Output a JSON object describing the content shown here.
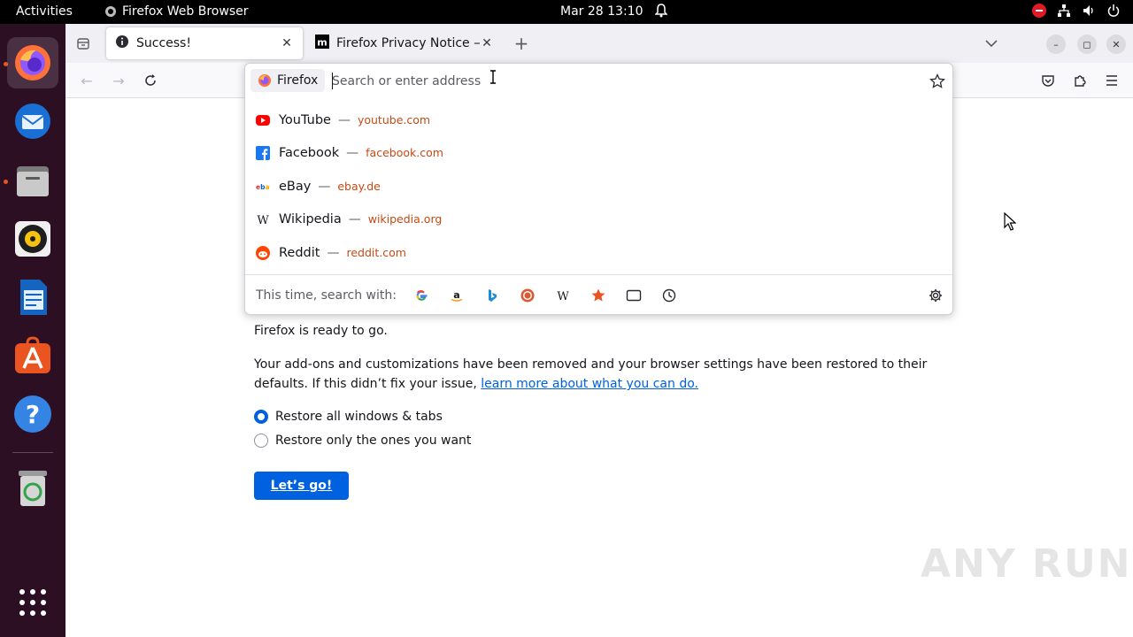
{
  "topbar": {
    "activities": "Activities",
    "app_name": "Firefox Web Browser",
    "clock": "Mar 28  13:10"
  },
  "dock": {
    "apps": [
      "firefox",
      "thunderbird",
      "files",
      "rhythmbox",
      "libreoffice-writer",
      "app-center",
      "help",
      "trash",
      "show-apps"
    ]
  },
  "tabs": [
    {
      "title": "Success!",
      "icon": "info-icon"
    },
    {
      "title": "Firefox Privacy Notice —",
      "icon": "mozilla-icon"
    }
  ],
  "urlbar": {
    "engine": "Firefox",
    "placeholder": "Search or enter address",
    "value": ""
  },
  "suggestions": [
    {
      "title": "YouTube",
      "url": "youtube.com",
      "icon": "youtube-icon"
    },
    {
      "title": "Facebook",
      "url": "facebook.com",
      "icon": "facebook-icon"
    },
    {
      "title": "eBay",
      "url": "ebay.de",
      "icon": "ebay-icon"
    },
    {
      "title": "Wikipedia",
      "url": "wikipedia.org",
      "icon": "wikipedia-icon"
    },
    {
      "title": "Reddit",
      "url": "reddit.com",
      "icon": "reddit-icon"
    }
  ],
  "separator": "—",
  "oneoff": {
    "label": "This time, search with:",
    "engines": [
      "google-icon",
      "amazon-icon",
      "bing-icon",
      "duckduckgo-icon",
      "wikipedia-icon",
      "bookmarks-icon",
      "tabs-icon",
      "history-icon"
    ]
  },
  "page": {
    "ready_text": "Firefox is ready to go.",
    "body_text_1": "Your add-ons and customizations have been removed and your browser settings have been restored to their",
    "body_text_2": "defaults. If this didn’t fix your issue,",
    "link_text": "learn more about what you can do.",
    "radio_all": "Restore all windows & tabs",
    "radio_some": "Restore only the ones you want",
    "button": "Let’s go!"
  },
  "watermark": "ANY RUN",
  "colors": {
    "accent": "#0061e0",
    "url_text": "#c64a15",
    "dock_bg": "#2c0f23",
    "ubuntu_orange": "#e95420"
  }
}
